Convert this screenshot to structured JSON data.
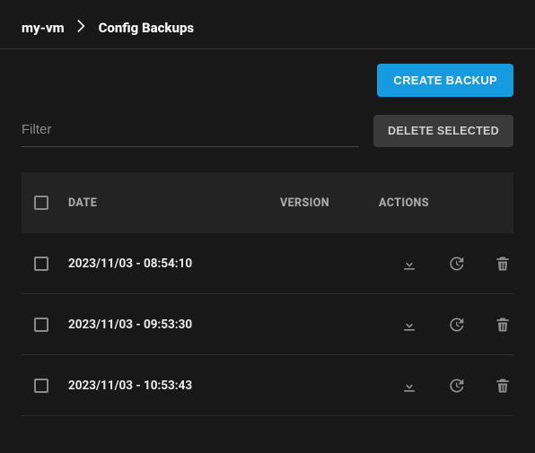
{
  "breadcrumb": {
    "root": "my-vm",
    "current": "Config Backups"
  },
  "buttons": {
    "create": "CREATE BACKUP",
    "delete_selected": "DELETE SELECTED"
  },
  "filter": {
    "placeholder": "Filter",
    "value": ""
  },
  "table": {
    "headers": {
      "date": "DATE",
      "version": "VERSION",
      "actions": "ACTIONS"
    },
    "rows": [
      {
        "date": "2023/11/03 - 08:54:10",
        "version": ""
      },
      {
        "date": "2023/11/03 - 09:53:30",
        "version": ""
      },
      {
        "date": "2023/11/03 - 10:53:43",
        "version": ""
      }
    ]
  },
  "icons": {
    "download": "download-icon",
    "restore": "restore-icon",
    "trash": "trash-icon"
  }
}
